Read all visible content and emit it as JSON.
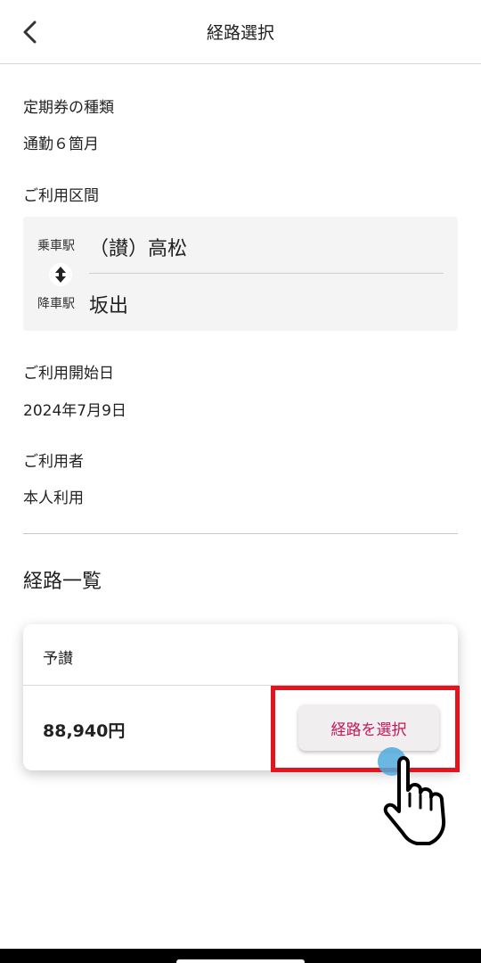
{
  "header": {
    "title": "経路選択",
    "back_icon": "chevron-left-icon"
  },
  "pass_type": {
    "label": "定期券の種類",
    "value": "通勤６箇月"
  },
  "section": {
    "label": "ご利用区間",
    "boarding_label": "乗車駅",
    "boarding_station": "（讃）高松",
    "alighting_label": "降車駅",
    "alighting_station": "坂出",
    "swap_icon": "swap-vertical-icon"
  },
  "start_date": {
    "label": "ご利用開始日",
    "value": "2024年7月9日"
  },
  "user": {
    "label": "ご利用者",
    "value": "本人利用"
  },
  "routes": {
    "title": "経路一覧",
    "items": [
      {
        "name": "予讃",
        "price": "88,940円",
        "button_label": "経路を選択"
      }
    ]
  },
  "colors": {
    "accent": "#c2185b",
    "highlight": "#e2141e",
    "tap_indicator": "#50aadc"
  }
}
